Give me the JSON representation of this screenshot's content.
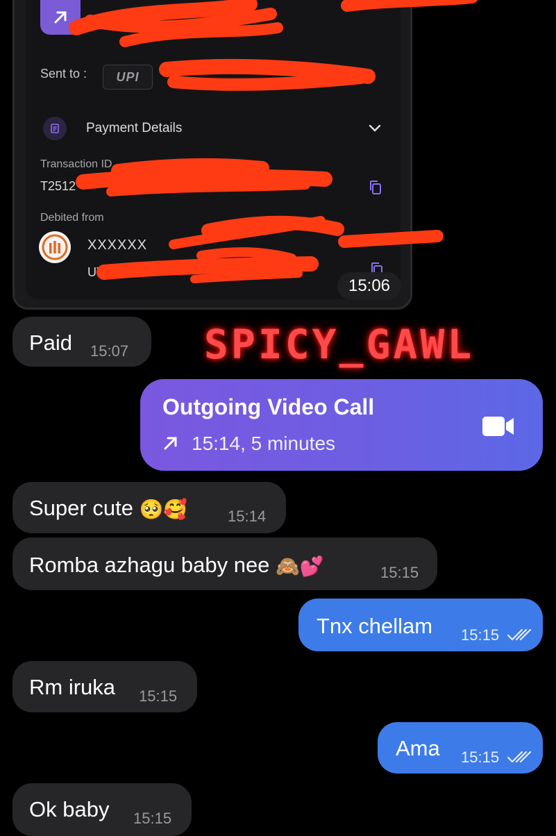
{
  "payment_card": {
    "sent_to_label": "Sent to :",
    "upi_logo_text": "UPI",
    "details_title": "Payment Details",
    "txn_label": "Transaction ID",
    "txn_value": "T2512",
    "debited_label": "Debited from",
    "account_value": "XXXXXX",
    "utr_value": "UT",
    "time": "15:06"
  },
  "watermark": "SPICY_GAWL",
  "messages": [
    {
      "side": "in",
      "text": "Paid",
      "time": "15:07"
    },
    {
      "side": "call",
      "title": "Outgoing Video Call",
      "detail": "15:14, 5 minutes"
    },
    {
      "side": "in",
      "text": "Super cute",
      "emoji": "🥺🥰",
      "time": "15:14"
    },
    {
      "side": "in",
      "text": "Romba azhagu baby nee",
      "emoji": "🙈💕",
      "time": "15:15"
    },
    {
      "side": "out",
      "text": "Tnx chellam",
      "time": "15:15"
    },
    {
      "side": "in",
      "text": "Rm iruka",
      "time": "15:15"
    },
    {
      "side": "out",
      "text": "Ama",
      "time": "15:15"
    },
    {
      "side": "in",
      "text": "Ok baby",
      "time": "15:15"
    }
  ],
  "icons": [
    "arrow-up-right-icon",
    "upi-logo",
    "document-icon",
    "chevron-down-icon",
    "copy-icon",
    "bank-logo",
    "video-camera-icon",
    "double-check-icon"
  ],
  "colors": {
    "incoming_bubble": "#262628",
    "outgoing_bubble": "#3d7be8",
    "call_bubble_start": "#7a58e0",
    "call_bubble_end": "#5c68e6",
    "redaction": "#ff3b14",
    "accent_purple": "#7b5cd6"
  }
}
